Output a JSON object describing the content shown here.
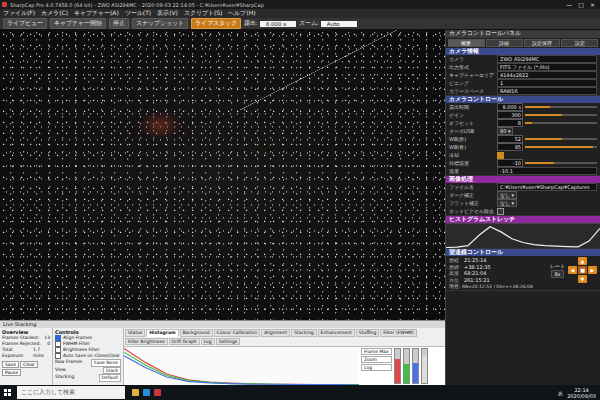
{
  "window": {
    "title": "SharpCap Pro 4.0.7458.0 (64 bit) - ZWO ASI294MC - 2020-09-03 22:14:05 - C:¥Users¥user¥SharpCap",
    "controls": [
      "—",
      "□",
      "×"
    ]
  },
  "menu": [
    "ファイル(F)",
    "カメラ(C)",
    "キャプチャー(A)",
    "ツール(T)",
    "表示(V)",
    "スクリプト(S)",
    "ヘルプ(H)"
  ],
  "toolbar": {
    "buttons": [
      {
        "label": "ライブビュー",
        "selected": false
      },
      {
        "label": "キャプチャー開始",
        "selected": false
      },
      {
        "label": "停止",
        "selected": false
      },
      {
        "label": "スナップショット",
        "selected": false
      },
      {
        "label": "ライブスタック",
        "selected": true
      }
    ],
    "fields": [
      {
        "label": "露出:",
        "value": "8.000 s"
      },
      {
        "label": "ズーム:",
        "value": "Auto"
      }
    ]
  },
  "panel": {
    "title": "カメラコントロールパネル",
    "tabs": [
      {
        "label": "概要",
        "selected": true
      },
      {
        "label": "詳細",
        "selected": false
      },
      {
        "label": "設定保存",
        "selected": false
      },
      {
        "label": "設定",
        "selected": false
      }
    ],
    "sections": [
      {
        "title": "カメラ情報",
        "color": "#3a4a8c",
        "rows": [
          {
            "kind": "field",
            "label": "カメラ",
            "value": "ZWO ASI294MC"
          },
          {
            "kind": "field",
            "label": "出力形式",
            "value": "FITS ファイル (*.fits)"
          },
          {
            "kind": "field",
            "label": "キャプチャーエリア",
            "value": "4144x2822"
          },
          {
            "kind": "field",
            "label": "ビニング",
            "value": "1"
          },
          {
            "kind": "field",
            "label": "カラースペース",
            "value": "RAW16"
          }
        ]
      },
      {
        "title": "カメラコントロール",
        "color": "#3a4a8c",
        "rows": [
          {
            "kind": "slider",
            "label": "露出時間",
            "value": "8.000 s",
            "level": 0.35
          },
          {
            "kind": "slider",
            "label": "ゲイン",
            "value": "300",
            "level": 0.52
          },
          {
            "kind": "slider",
            "label": "オフセット",
            "value": "8",
            "level": 0.1
          },
          {
            "kind": "select",
            "label": "ターボUSB",
            "value": "80"
          },
          {
            "kind": "slider",
            "label": "WB(赤)",
            "value": "52",
            "level": 0.52
          },
          {
            "kind": "slider",
            "label": "WB(青)",
            "value": "95",
            "level": 0.95
          },
          {
            "kind": "check",
            "label": "冷却",
            "checked": true
          },
          {
            "kind": "slider",
            "label": "目標温度",
            "value": "-10",
            "level": 0.4
          },
          {
            "kind": "field",
            "label": "温度",
            "value": "-10.1"
          }
        ]
      },
      {
        "title": "画像処理",
        "color": "#8e2a9e",
        "rows": [
          {
            "kind": "field",
            "label": "ファイル名",
            "value": "C:¥Users¥user¥SharpCap¥Captures"
          },
          {
            "kind": "select",
            "label": "ダーク補正",
            "value": "なし"
          },
          {
            "kind": "select",
            "label": "フラット補正",
            "value": "なし"
          },
          {
            "kind": "check",
            "label": "ホットピクセル除去",
            "checked": false
          }
        ]
      }
    ],
    "stretch": {
      "title": "ヒストグラムストレッチ",
      "color": "#8e2a9e",
      "values": [
        2,
        4,
        10,
        55,
        92,
        70,
        40,
        24,
        15,
        10,
        8,
        6,
        5,
        30,
        85
      ]
    },
    "telescope": {
      "title": "望遠鏡コントロール",
      "color": "#3a4a8c",
      "rows": [
        {
          "label": "赤経",
          "value": "21:25:14"
        },
        {
          "label": "赤緯",
          "value": "+38:12:35"
        },
        {
          "label": "高度",
          "value": "68:21:04"
        },
        {
          "label": "方位",
          "value": "261:15:21"
        }
      ],
      "rate": {
        "label": "レート",
        "value": "8x"
      },
      "pad": [
        "▲",
        "◀",
        "■",
        "▶",
        "▼"
      ],
      "footer": "現在: RA=20:12:53 / Dec=+38:26:08"
    }
  },
  "live_stack": {
    "title": "Live Stacking",
    "overview": {
      "title": "Overview",
      "rows": [
        {
          "label": "Frames Stacked:",
          "value": "13"
        },
        {
          "label": "Frames Rejected:",
          "value": "0"
        },
        {
          "label": "Total Exposure:",
          "value": "1.7 mins"
        }
      ],
      "buttons": [
        "Save",
        "Clear",
        "Pause"
      ]
    },
    "controls": {
      "title": "Controls",
      "checks": [
        {
          "label": "Align Frames",
          "checked": true
        },
        {
          "label": "FWHM Filter",
          "checked": false
        },
        {
          "label": "Brightness Filter",
          "checked": false
        },
        {
          "label": "Auto Save on Close/Clear",
          "checked": false
        }
      ],
      "fields": [
        {
          "label": "Raw Frames",
          "value": "Save None"
        },
        {
          "label": "View",
          "value": "Stack"
        },
        {
          "label": "Stacking",
          "value": "Default"
        }
      ]
    },
    "tabs": [
      {
        "label": "Status",
        "selected": false
      },
      {
        "label": "Histogram",
        "selected": true
      },
      {
        "label": "Background",
        "selected": false
      },
      {
        "label": "Colour Calibration",
        "selected": false
      },
      {
        "label": "Alignment",
        "selected": false
      },
      {
        "label": "Stacking",
        "selected": false
      },
      {
        "label": "Enhancement",
        "selected": false
      },
      {
        "label": "Stuffing",
        "selected": false
      },
      {
        "label": "Filter (FWHM)",
        "selected": false
      },
      {
        "label": "Filter Brightness",
        "selected": false
      },
      {
        "label": "Drift Graph",
        "selected": false
      },
      {
        "label": "Log",
        "selected": false
      },
      {
        "label": "Settings",
        "selected": false
      }
    ],
    "histogram": {
      "labels": [
        "Frame Max",
        "Zoom",
        "Log"
      ],
      "series": [
        {
          "name": "R",
          "color": "#e04848",
          "values": [
            100,
            62,
            30,
            14,
            8,
            5,
            3,
            2,
            2,
            1,
            1,
            1
          ]
        },
        {
          "name": "G",
          "color": "#40c040",
          "values": [
            90,
            55,
            26,
            12,
            7,
            4,
            3,
            2,
            1,
            1,
            1,
            1
          ]
        },
        {
          "name": "B",
          "color": "#4a70e8",
          "values": [
            80,
            48,
            22,
            10,
            6,
            4,
            2,
            2,
            1,
            1,
            1,
            0
          ]
        }
      ],
      "levels": [
        {
          "name": "R",
          "color": "#e04848",
          "level": 0.7
        },
        {
          "name": "G",
          "color": "#40c040",
          "level": 0.55
        },
        {
          "name": "B",
          "color": "#4a70e8",
          "level": 0.6
        },
        {
          "name": "L",
          "color": "#dddddd",
          "level": 0.8
        }
      ]
    }
  },
  "taskbar": {
    "search": "ここに入力して検索",
    "ime": "あ",
    "time": "22:14",
    "date": "2020/09/03"
  }
}
